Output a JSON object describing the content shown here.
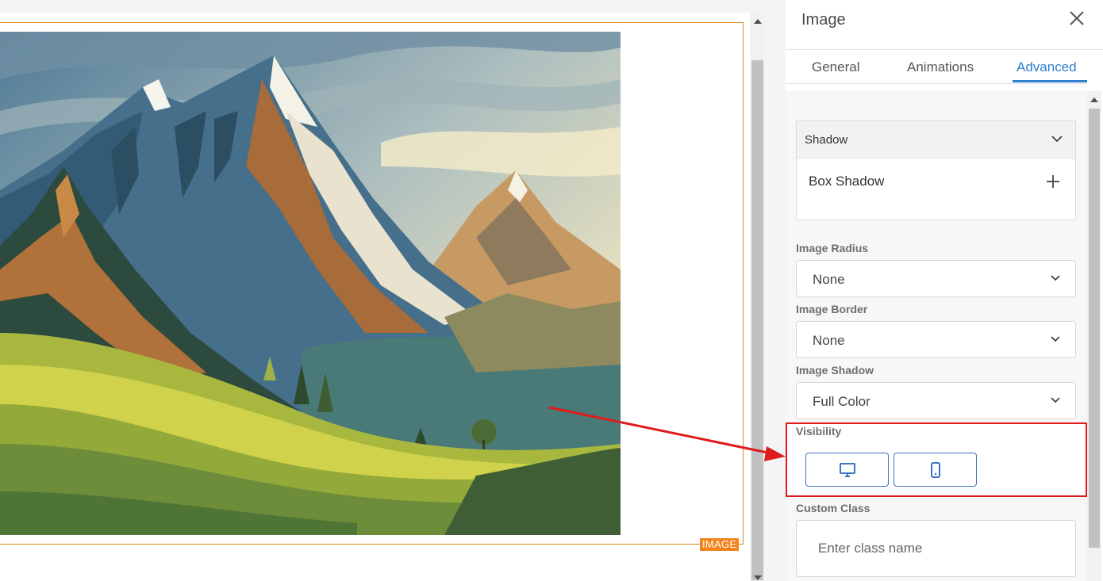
{
  "canvas": {
    "element_badge": "IMAGE"
  },
  "panel": {
    "title": "Image",
    "tabs": [
      {
        "label": "General",
        "active": false
      },
      {
        "label": "Animations",
        "active": false
      },
      {
        "label": "Advanced",
        "active": true
      }
    ],
    "shadow_section": {
      "title": "Shadow",
      "box_shadow_label": "Box Shadow"
    },
    "fields": {
      "image_radius": {
        "label": "Image Radius",
        "value": "None"
      },
      "image_border": {
        "label": "Image Border",
        "value": "None"
      },
      "image_shadow": {
        "label": "Image Shadow",
        "value": "Full Color"
      }
    },
    "visibility": {
      "label": "Visibility",
      "buttons": [
        {
          "icon": "desktop-icon"
        },
        {
          "icon": "mobile-icon"
        }
      ]
    },
    "custom_class": {
      "label": "Custom Class",
      "placeholder": "Enter class name"
    }
  },
  "colors": {
    "accent": "#2f80d1",
    "highlight": "#e01b1b",
    "selection": "#e08a1e",
    "badge": "#f2841c"
  }
}
